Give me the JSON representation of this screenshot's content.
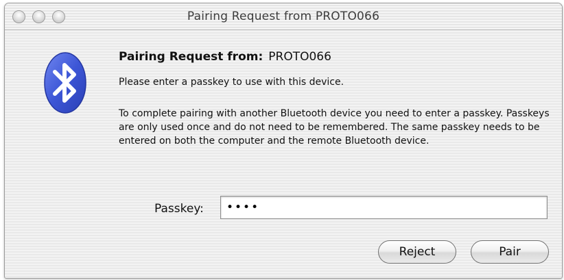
{
  "window": {
    "title": "Pairing Request from  PROTO066"
  },
  "dialog": {
    "heading_label": "Pairing Request from:",
    "heading_device": "PROTO066",
    "subtitle": "Please enter a passkey to use with this device.",
    "description": "To complete pairing with another Bluetooth device you need to enter a passkey.  Passkeys are only used once and do not need to be remembered.  The same passkey needs to be entered on both the computer and the remote Bluetooth device.",
    "passkey_label": "Passkey:",
    "passkey_value": "••••"
  },
  "buttons": {
    "reject": "Reject",
    "pair": "Pair"
  },
  "icons": {
    "bluetooth": "bluetooth-icon",
    "close": "close-icon",
    "minimize": "minimize-icon",
    "zoom": "zoom-icon"
  },
  "colors": {
    "bluetooth_blue": "#3d56d6",
    "bluetooth_symbol": "#ffffff"
  }
}
